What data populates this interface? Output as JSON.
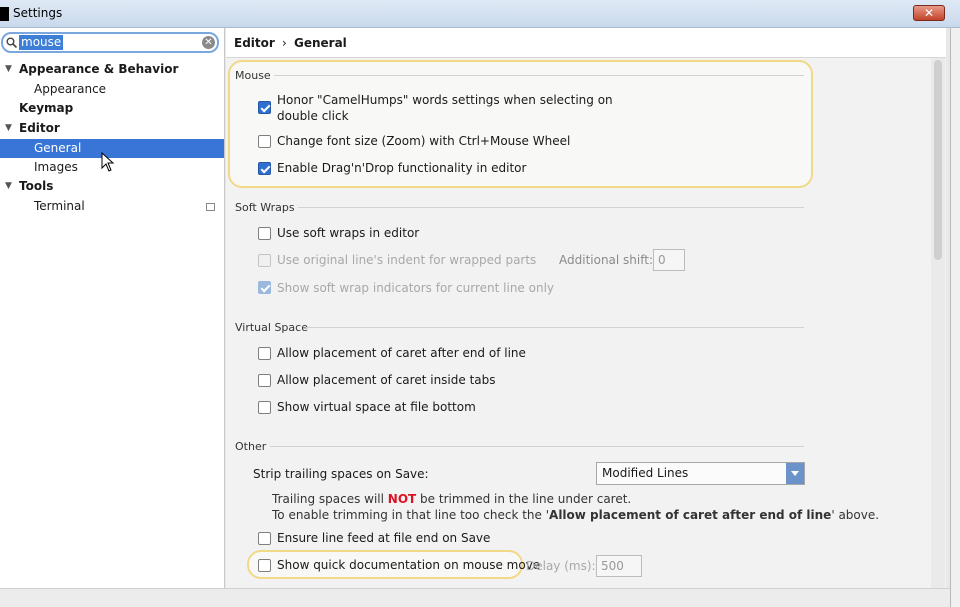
{
  "window": {
    "title": "Settings",
    "close_label": "✕"
  },
  "search": {
    "value": "mouse"
  },
  "tree": [
    {
      "label": "Appearance & Behavior",
      "bold": true,
      "expanded": true
    },
    {
      "label": "Appearance"
    },
    {
      "label": "Keymap",
      "bold": true
    },
    {
      "label": "Editor",
      "bold": true,
      "expanded": true
    },
    {
      "label": "General",
      "selected": true
    },
    {
      "label": "Images"
    },
    {
      "label": "Tools",
      "bold": true,
      "expanded": true
    },
    {
      "label": "Terminal"
    }
  ],
  "breadcrumb": {
    "parent": "Editor",
    "separator": "›",
    "current": "General"
  },
  "mouse": {
    "title": "Mouse",
    "honor_line1": "Honor \"CamelHumps\" words settings when selecting on",
    "honor_line2": "double click",
    "honor_checked": true,
    "zoom": "Change font size (Zoom) with Ctrl+Mouse Wheel",
    "zoom_checked": false,
    "dnd": "Enable Drag'n'Drop functionality in editor",
    "dnd_checked": true
  },
  "soft_wraps": {
    "title": "Soft Wraps",
    "use": "Use soft wraps in editor",
    "indent": "Use original line's indent for wrapped parts",
    "shift_label": "Additional shift:",
    "shift_value": "0",
    "indicators": "Show soft wrap indicators for current line only"
  },
  "virtual_space": {
    "title": "Virtual Space",
    "after_end": "Allow placement of caret after end of line",
    "inside_tabs": "Allow placement of caret inside tabs",
    "file_bottom": "Show virtual space at file bottom"
  },
  "other": {
    "title": "Other",
    "strip_label": "Strip trailing spaces on Save:",
    "strip_value": "Modified Lines",
    "note1_a": "Trailing spaces will ",
    "note1_not": "NOT",
    "note1_b": " be trimmed in the line under caret.",
    "note2_a": "To enable trimming in that line too check the '",
    "note2_bold": "Allow placement of caret after end of line",
    "note2_b": "' above.",
    "line_feed": "Ensure line feed at file end on Save",
    "quick_doc": "Show quick documentation on mouse move",
    "delay_label": "Delay (ms):",
    "delay_value": "500"
  },
  "colors": {
    "selection": "#3875d7",
    "highlight": "#f1d988",
    "checkbox": "#2e6fd1",
    "not_red": "#d12"
  }
}
